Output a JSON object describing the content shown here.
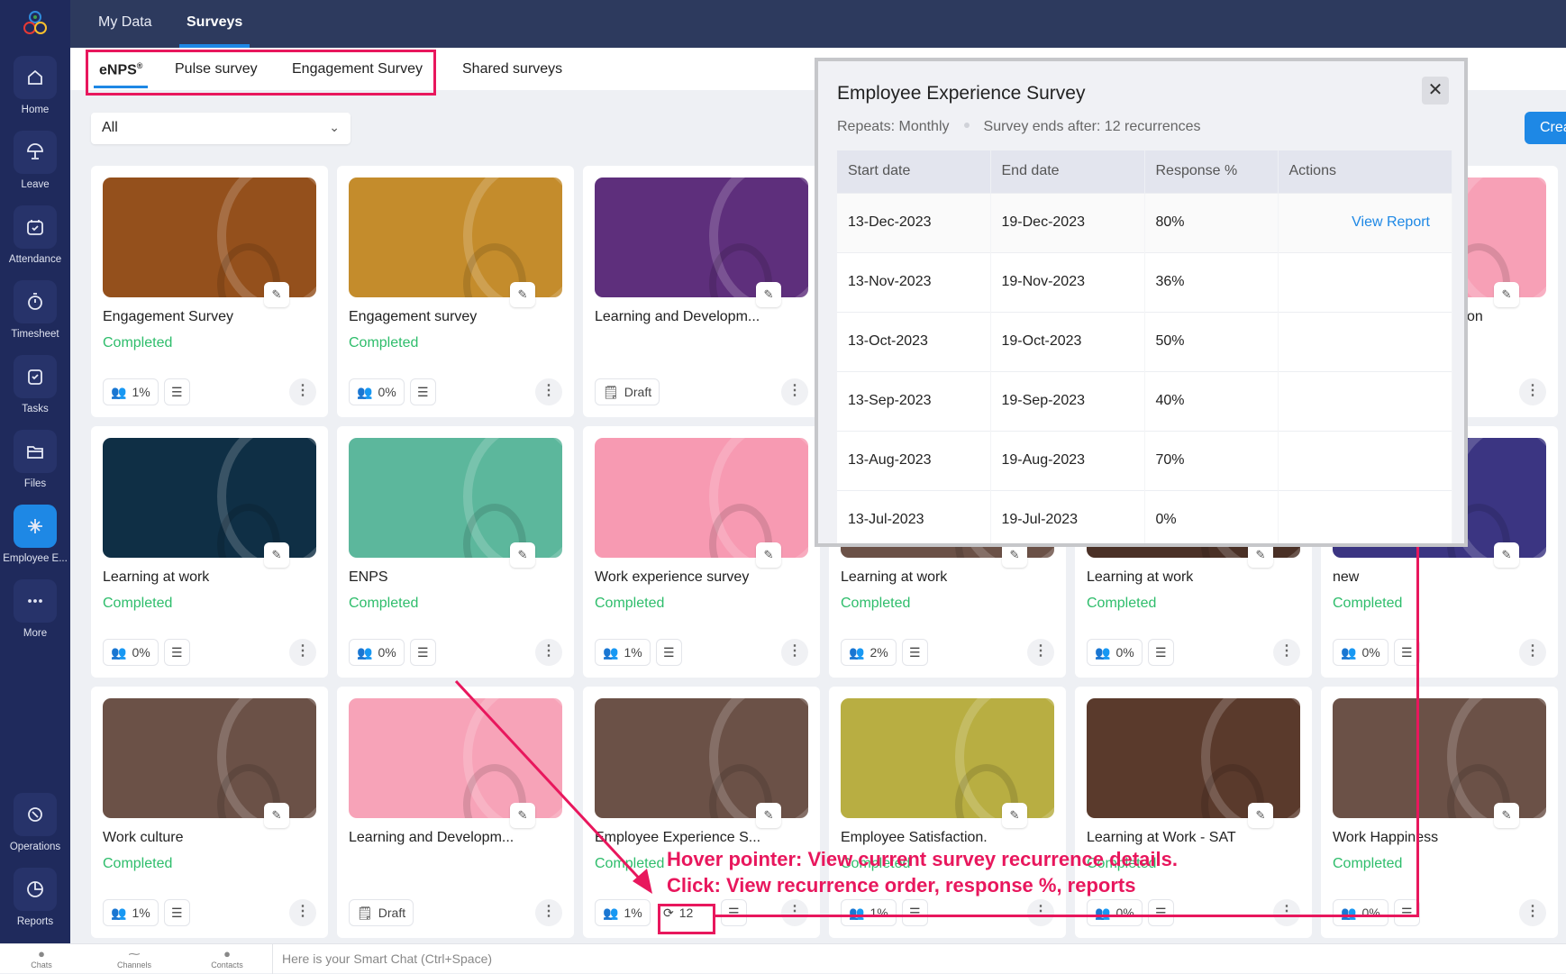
{
  "sidebar": {
    "items": [
      {
        "label": "Home",
        "icon": "home-icon"
      },
      {
        "label": "Leave",
        "icon": "umbrella-icon"
      },
      {
        "label": "Attendance",
        "icon": "calendar-check-icon"
      },
      {
        "label": "Timesheet",
        "icon": "stopwatch-icon"
      },
      {
        "label": "Tasks",
        "icon": "clipboard-check-icon"
      },
      {
        "label": "Files",
        "icon": "folder-icon"
      },
      {
        "label": "Employee E...",
        "icon": "employee-engagement-icon",
        "active": true
      },
      {
        "label": "More",
        "icon": "more-icon"
      }
    ],
    "bottom_items": [
      {
        "label": "Operations",
        "icon": "operations-icon"
      },
      {
        "label": "Reports",
        "icon": "reports-icon"
      }
    ]
  },
  "topnav": {
    "tabs": [
      "My Data",
      "Surveys"
    ],
    "active": "Surveys"
  },
  "subnav": {
    "tabs": [
      "eNPS",
      "Pulse survey",
      "Engagement Survey",
      "Shared surveys"
    ],
    "enps_mark": "®",
    "active": "eNPS"
  },
  "filter": {
    "value": "All"
  },
  "create_button": "Crea",
  "cards": [
    {
      "title": "Engagement Survey",
      "status": "Completed",
      "response": "1%",
      "color": "#94501c"
    },
    {
      "title": "Engagement survey",
      "status": "Completed",
      "response": "0%",
      "color": "#c48c2c"
    },
    {
      "title": "Learning and Developm...",
      "draft": "Draft",
      "color": "#5e2f7c"
    },
    {
      "title": "",
      "color": "#6b5147"
    },
    {
      "title": "",
      "color": "#5a3a2c"
    },
    {
      "title": "on",
      "color": "#f7a0b6"
    },
    {
      "title": "Learning at work",
      "status": "Completed",
      "response": "0%",
      "color": "#0f2f45"
    },
    {
      "title": "ENPS",
      "status": "Completed",
      "response": "0%",
      "color": "#5cb79c"
    },
    {
      "title": "Work experience survey",
      "status": "Completed",
      "response": "1%",
      "color": "#f79ab2"
    },
    {
      "title": "Learning at work",
      "status": "Completed",
      "response": "2%",
      "color": "#6b5147"
    },
    {
      "title": "Learning at work",
      "status": "Completed",
      "response": "0%",
      "color": "#4a3026"
    },
    {
      "title": "new",
      "status": "Completed",
      "response": "0%",
      "color": "#3b3582"
    },
    {
      "title": "Work culture",
      "status": "Completed",
      "response": "1%",
      "color": "#6b5147"
    },
    {
      "title": "Learning and Developm...",
      "draft": "Draft",
      "color": "#f7a3b8"
    },
    {
      "title": "Employee Experience S...",
      "status": "Completed",
      "response": "1%",
      "recurrence": "12",
      "color": "#6b5147"
    },
    {
      "title": "Employee Satisfaction.",
      "status": "Completed",
      "response": "1%",
      "color": "#b8ae42"
    },
    {
      "title": "Learning at Work - SAT",
      "status": "Completed",
      "response": "0%",
      "color": "#5a3a2c"
    },
    {
      "title": "Work Happiness",
      "status": "Completed",
      "response": "0%",
      "color": "#6b5147"
    }
  ],
  "modal": {
    "title": "Employee Experience Survey",
    "repeats": "Repeats: Monthly",
    "ends": "Survey ends after: 12 recurrences",
    "columns": [
      "Start date",
      "End date",
      "Response %",
      "Actions"
    ],
    "rows": [
      {
        "start": "13-Dec-2023",
        "end": "19-Dec-2023",
        "response": "80%",
        "action": "View Report"
      },
      {
        "start": "13-Nov-2023",
        "end": "19-Nov-2023",
        "response": "36%",
        "action": ""
      },
      {
        "start": "13-Oct-2023",
        "end": "19-Oct-2023",
        "response": "50%",
        "action": ""
      },
      {
        "start": "13-Sep-2023",
        "end": "19-Sep-2023",
        "response": "40%",
        "action": ""
      },
      {
        "start": "13-Aug-2023",
        "end": "19-Aug-2023",
        "response": "70%",
        "action": ""
      },
      {
        "start": "13-Jul-2023",
        "end": "19-Jul-2023",
        "response": "0%",
        "action": ""
      }
    ]
  },
  "bottombar": {
    "items": [
      "Chats",
      "Channels",
      "Contacts"
    ],
    "smart_chat": "Here is your Smart Chat (Ctrl+Space)"
  },
  "annotations": {
    "line1": "Hover pointer: View current survey recurrence details.",
    "line2": "Click: View recurrence order, response %, reports",
    "color": "#e8175d"
  }
}
